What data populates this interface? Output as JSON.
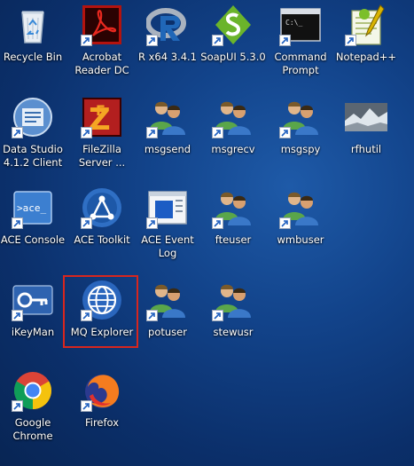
{
  "desktop": {
    "icons": [
      {
        "label": "Recycle Bin",
        "icon": "recycle-bin-icon"
      },
      {
        "label": "Acrobat\nReader DC",
        "icon": "acrobat-icon"
      },
      {
        "label": "R x64 3.4.1",
        "icon": "r-icon"
      },
      {
        "label": "SoapUI 5.3.0",
        "icon": "soapui-icon"
      },
      {
        "label": "Command\nPrompt",
        "icon": "command-prompt-icon"
      },
      {
        "label": "Notepad++",
        "icon": "notepad-plus-icon"
      },
      {
        "label": "Data Studio\n4.1.2 Client",
        "icon": "data-studio-icon"
      },
      {
        "label": "FileZilla\nServer ...",
        "icon": "filezilla-icon"
      },
      {
        "label": "msgsend",
        "icon": "users-icon"
      },
      {
        "label": "msgrecv",
        "icon": "users-icon"
      },
      {
        "label": "msgspy",
        "icon": "users-icon"
      },
      {
        "label": "rfhutil",
        "icon": "rfhutil-icon"
      },
      {
        "label": "ACE Console",
        "icon": "ace-console-icon"
      },
      {
        "label": "ACE Toolkit",
        "icon": "ace-toolkit-icon"
      },
      {
        "label": "ACE Event\nLog",
        "icon": "ace-event-log-icon"
      },
      {
        "label": "fteuser",
        "icon": "users-icon"
      },
      {
        "label": "wmbuser",
        "icon": "users-icon"
      },
      {
        "label": "iKeyMan",
        "icon": "ikeyman-icon"
      },
      {
        "label": "MQ Explorer",
        "icon": "mq-explorer-icon"
      },
      {
        "label": "potuser",
        "icon": "users-icon"
      },
      {
        "label": "stewusr",
        "icon": "users-icon"
      },
      {
        "label": "Google\nChrome",
        "icon": "chrome-icon"
      },
      {
        "label": "Firefox",
        "icon": "firefox-icon"
      }
    ],
    "highlighted": "MQ Explorer",
    "highlight_color": "#d7261e"
  }
}
